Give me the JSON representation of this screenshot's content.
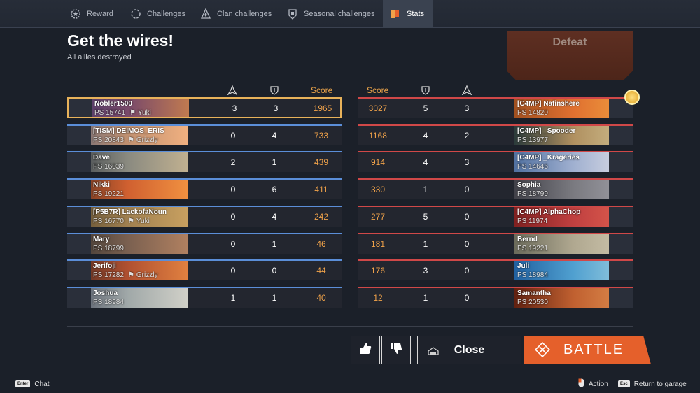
{
  "tabs": [
    {
      "label": "Reward",
      "icon": "gear-star-icon"
    },
    {
      "label": "Challenges",
      "icon": "dashed-circle-icon"
    },
    {
      "label": "Clan challenges",
      "icon": "flame-badge-icon"
    },
    {
      "label": "Seasonal challenges",
      "icon": "hand-badge-icon"
    },
    {
      "label": "Stats",
      "icon": "stats-cards-icon"
    }
  ],
  "title": "Get the wires!",
  "subtitle": "All allies destroyed",
  "result": "Defeat",
  "headers": {
    "score": "Score"
  },
  "allies": [
    {
      "name": "Nobler1500",
      "ps": "PS 15741",
      "clan": "Yuki",
      "kills": "3",
      "assists": "3",
      "score": "1965"
    },
    {
      "name": "[TISM] DEIMOS_ERIS",
      "ps": "PS 20843",
      "clan": "Grizzly",
      "kills": "0",
      "assists": "4",
      "score": "733"
    },
    {
      "name": "Dave",
      "ps": "PS 16039",
      "clan": "",
      "kills": "2",
      "assists": "1",
      "score": "439"
    },
    {
      "name": "Nikki",
      "ps": "PS 19221",
      "clan": "",
      "kills": "0",
      "assists": "6",
      "score": "411"
    },
    {
      "name": "[P5B7R] LackofaNoun",
      "ps": "PS 16770",
      "clan": "Yuki",
      "kills": "0",
      "assists": "4",
      "score": "242"
    },
    {
      "name": "Mary",
      "ps": "PS 18799",
      "clan": "",
      "kills": "0",
      "assists": "1",
      "score": "46"
    },
    {
      "name": "Jerifoji",
      "ps": "PS 17282",
      "clan": "Grizzly",
      "kills": "0",
      "assists": "0",
      "score": "44"
    },
    {
      "name": "Joshua",
      "ps": "PS 18984",
      "clan": "",
      "kills": "1",
      "assists": "1",
      "score": "40"
    }
  ],
  "enemies": [
    {
      "name": "[C4MP] Nafinshere",
      "ps": "PS 14820",
      "score": "3027",
      "assists": "5",
      "kills": "3"
    },
    {
      "name": "[C4MP] _Spooder",
      "ps": "PS 13977",
      "score": "1168",
      "assists": "4",
      "kills": "2"
    },
    {
      "name": "[C4MP] _Krageries",
      "ps": "PS 14646",
      "score": "914",
      "assists": "4",
      "kills": "3"
    },
    {
      "name": "Sophia",
      "ps": "PS 18799",
      "score": "330",
      "assists": "1",
      "kills": "0"
    },
    {
      "name": "[C4MP] AlphaChop",
      "ps": "PS 11974",
      "score": "277",
      "assists": "5",
      "kills": "0"
    },
    {
      "name": "Bernd",
      "ps": "PS 19221",
      "score": "181",
      "assists": "1",
      "kills": "0"
    },
    {
      "name": "Juli",
      "ps": "PS 18984",
      "score": "176",
      "assists": "3",
      "kills": "0"
    },
    {
      "name": "Samantha",
      "ps": "PS 20530",
      "score": "12",
      "assists": "1",
      "kills": "0"
    }
  ],
  "buttons": {
    "close": "Close",
    "battle": "BATTLE"
  },
  "footer": {
    "chat_key": "Enter",
    "chat": "Chat",
    "action": "Action",
    "return_key": "Esc",
    "return": "Return to garage"
  },
  "colors": {
    "accent": "#e5602b",
    "score": "#f0a24a",
    "ally": "#5b8ed8",
    "enemy": "#d04848",
    "highlight": "#e8b25a"
  }
}
